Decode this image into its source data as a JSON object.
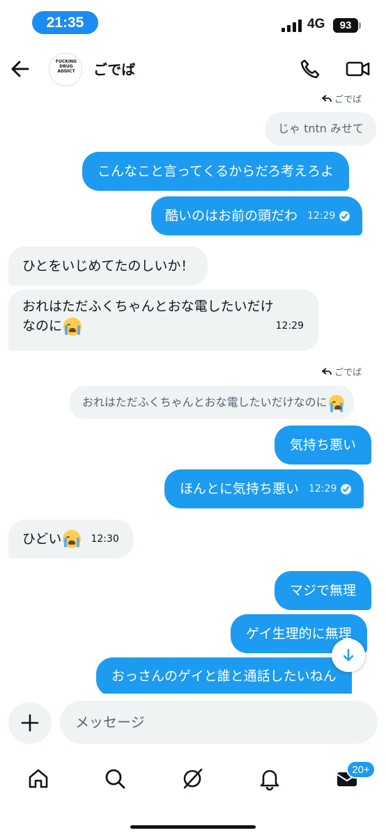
{
  "status_bar": {
    "time": "21:35",
    "network": "4G",
    "battery": "93"
  },
  "header": {
    "contact_name": "ごでば",
    "avatar_text": "FUCKING DRUG ADDICT"
  },
  "messages": [
    {
      "kind": "reply_indicator",
      "text": "ごでば"
    },
    {
      "kind": "quote",
      "text": "じゃ tntn みせて"
    },
    {
      "kind": "out",
      "text": "こんなこと言ってくるからだろ考えろよ"
    },
    {
      "kind": "out",
      "text": "酷いのはお前の頭だわ",
      "time": "12:29"
    },
    {
      "kind": "in",
      "text": "ひとをいじめてたのしいか！"
    },
    {
      "kind": "in",
      "line1": "おれはただふくちゃんとおな電したいだけ",
      "line2": "なのに",
      "time": "12:29"
    },
    {
      "kind": "reply_indicator",
      "text": "ごでば"
    },
    {
      "kind": "quote",
      "text": "おれはただふくちゃんとおな電したいだけなのに"
    },
    {
      "kind": "out",
      "text": "気持ち悪い"
    },
    {
      "kind": "out",
      "text": "ほんとに気持ち悪い",
      "time": "12:29"
    },
    {
      "kind": "in",
      "text": "ひどい",
      "time": "12:30"
    },
    {
      "kind": "out",
      "text": "マジで無理"
    },
    {
      "kind": "out",
      "text": "ゲイ生理的に無理"
    },
    {
      "kind": "out",
      "text": "おっさんのゲイと誰と通話したいねん"
    }
  ],
  "composer": {
    "placeholder": "メッセージ"
  },
  "nav": {
    "items": [
      "home",
      "search",
      "grok",
      "notifications",
      "messages"
    ],
    "messages_badge": "20+"
  },
  "colors": {
    "accent": "#1d9bf0",
    "incoming": "#eff3f4",
    "text": "#0f1419",
    "muted": "#536471"
  }
}
